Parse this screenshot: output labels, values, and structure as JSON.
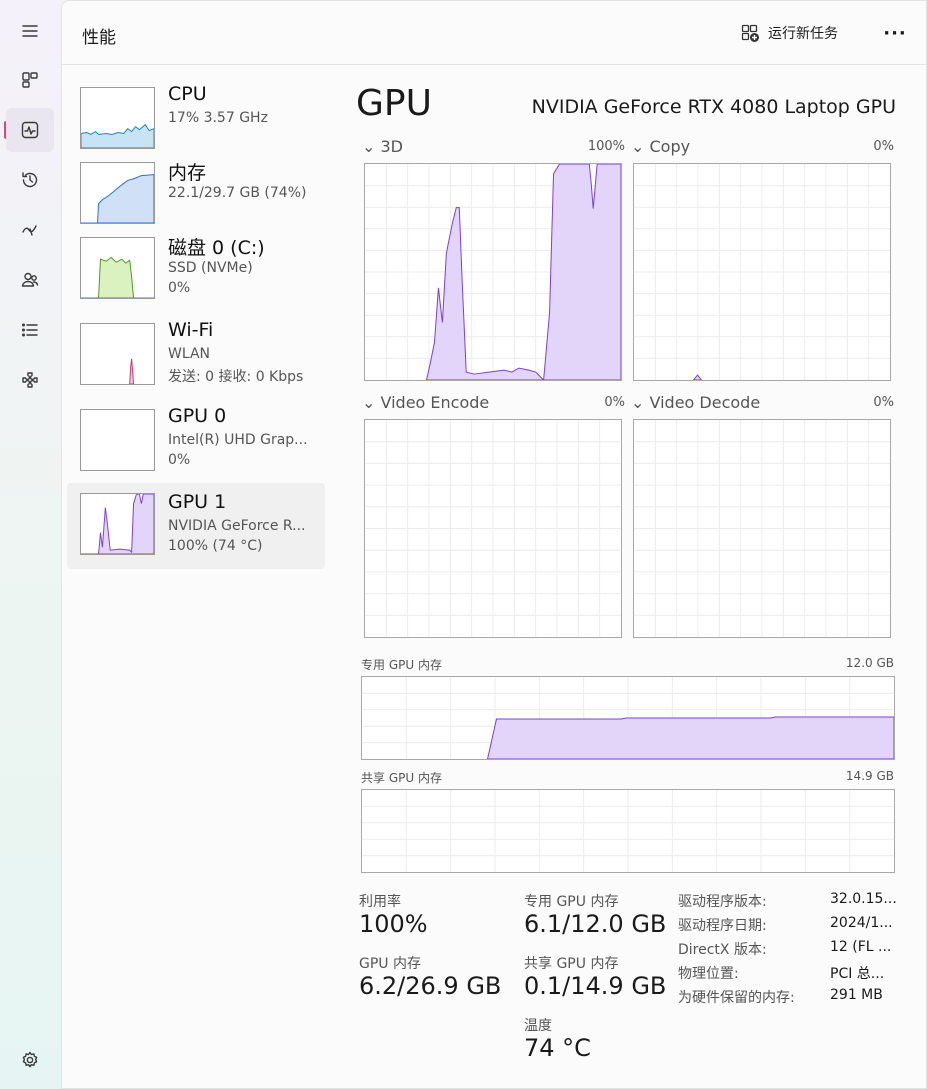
{
  "header": {
    "title": "性能",
    "run_task_label": "运行新任务",
    "more_label": "···"
  },
  "nav": [
    "menu-icon",
    "processes-icon",
    "performance-icon",
    "app-history-icon",
    "startup-apps-icon",
    "users-icon",
    "details-icon",
    "services-icon",
    "settings-icon"
  ],
  "devices": [
    {
      "name": "CPU",
      "line1": "17% 3.57 GHz",
      "line2": "",
      "color": "#1a86c7",
      "fill": "#c7e3f4"
    },
    {
      "name": "内存",
      "line1": "22.1/29.7 GB (74%)",
      "line2": "",
      "color": "#2a6fd1",
      "fill": "#cfe0f7"
    },
    {
      "name": "磁盘 0 (C:)",
      "line1": "SSD (NVMe)",
      "line2": "0%",
      "color": "#4c9a1c",
      "fill": "#d9f2c0"
    },
    {
      "name": "Wi-Fi",
      "line1": "WLAN",
      "line2": "发送: 0 接收: 0 Kbps",
      "color": "#c23a7a",
      "fill": "#f3c9dc"
    },
    {
      "name": "GPU 0",
      "line1": "Intel(R) UHD Grap...",
      "line2": "0%",
      "color": "#7c3fd6",
      "fill": "#e3d4f9"
    },
    {
      "name": "GPU 1",
      "line1": "NVIDIA GeForce R...",
      "line2": "100% (74 °C)",
      "color": "#7c3fd6",
      "fill": "#e3d4f9"
    }
  ],
  "gpu": {
    "title": "GPU",
    "model": "NVIDIA GeForce RTX 4080 Laptop GPU",
    "engines": [
      {
        "label": "3D",
        "percent": "100%"
      },
      {
        "label": "Copy",
        "percent": "0%"
      },
      {
        "label": "Video Encode",
        "percent": "0%"
      },
      {
        "label": "Video Decode",
        "percent": "0%"
      }
    ],
    "dedicated_label": "专用 GPU 内存",
    "dedicated_max": "12.0 GB",
    "shared_label": "共享 GPU 内存",
    "shared_max": "14.9 GB"
  },
  "stats": {
    "utilization_label": "利用率",
    "utilization_value": "100%",
    "gpu_mem_label": "GPU 内存",
    "gpu_mem_value": "6.2/26.9 GB",
    "dedicated_label": "专用 GPU 内存",
    "dedicated_value": "6.1/12.0 GB",
    "shared_label": "共享 GPU 内存",
    "shared_value": "0.1/14.9 GB",
    "temp_label": "温度",
    "temp_value": "74 °C"
  },
  "info": [
    {
      "key": "驱动程序版本:",
      "value": "32.0.15..."
    },
    {
      "key": "驱动程序日期:",
      "value": "2024/1..."
    },
    {
      "key": "DirectX 版本:",
      "value": "12 (FL ..."
    },
    {
      "key": "物理位置:",
      "value": "PCI 总..."
    },
    {
      "key": "为硬件保留的内存:",
      "value": "291 MB"
    }
  ],
  "colors": {
    "gpu_line": "#7c3fd6",
    "gpu_fill": "#e3d4f9",
    "grid": "#ececec",
    "accent": "#e0457b"
  }
}
